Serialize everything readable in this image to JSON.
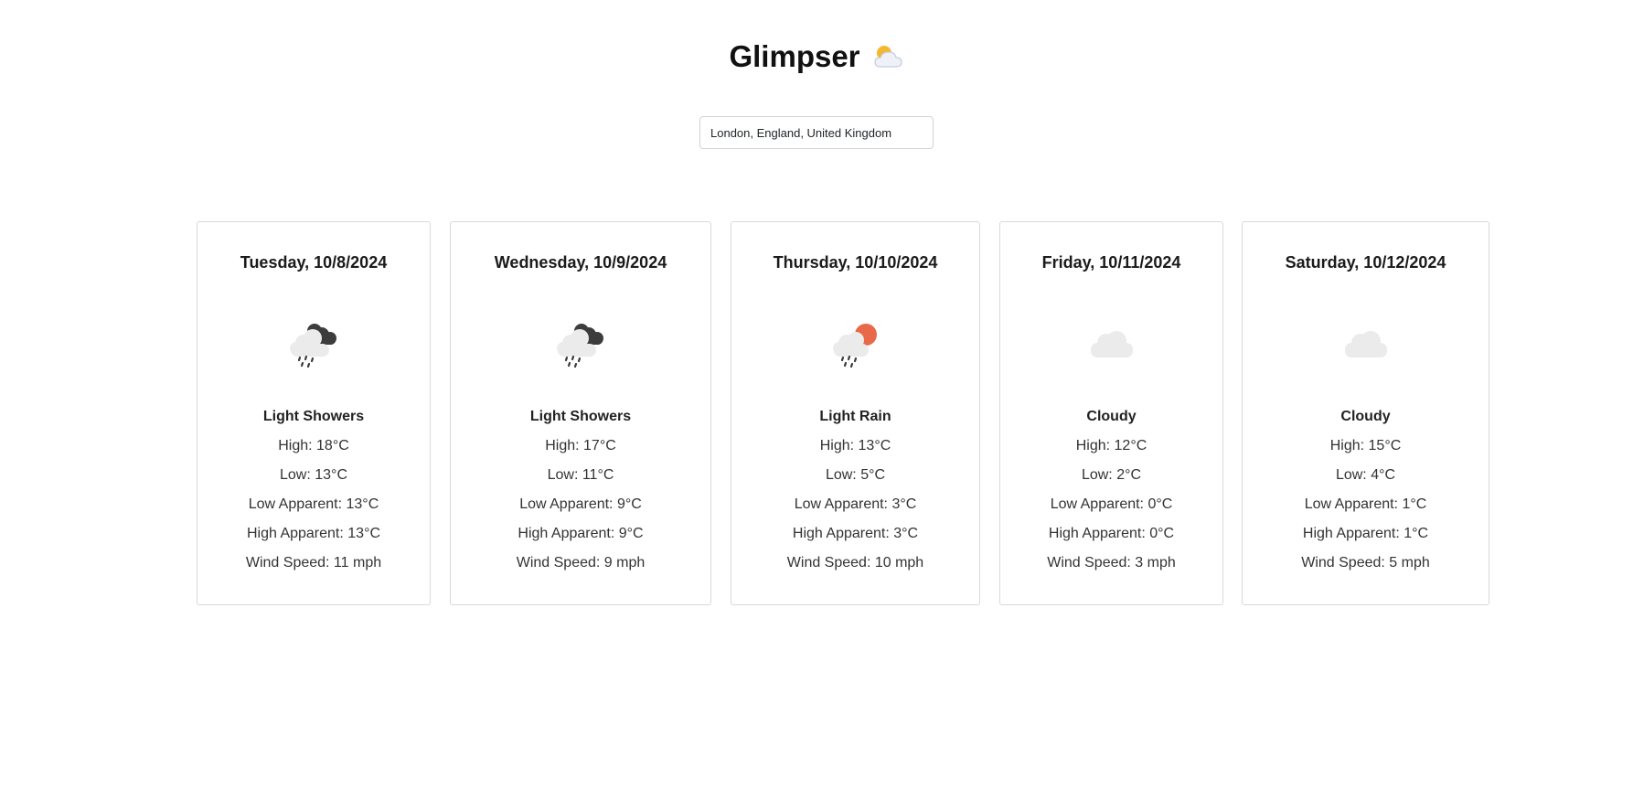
{
  "app": {
    "title": "Glimpser",
    "title_icon": "sun-behind-cloud-icon"
  },
  "search": {
    "value": "London, England, United Kingdom"
  },
  "forecast": [
    {
      "date": "Tuesday, 10/8/2024",
      "icon": "cloud-rain-showers-icon",
      "condition": "Light Showers",
      "high": "High: 18°C",
      "low": "Low: 13°C",
      "low_apparent": "Low Apparent: 13°C",
      "high_apparent": "High Apparent: 13°C",
      "wind": "Wind Speed: 11 mph"
    },
    {
      "date": "Wednesday, 10/9/2024",
      "icon": "cloud-rain-showers-icon",
      "condition": "Light Showers",
      "high": "High: 17°C",
      "low": "Low: 11°C",
      "low_apparent": "Low Apparent: 9°C",
      "high_apparent": "High Apparent: 9°C",
      "wind": "Wind Speed: 9 mph"
    },
    {
      "date": "Thursday, 10/10/2024",
      "icon": "sun-cloud-rain-icon",
      "condition": "Light Rain",
      "high": "High: 13°C",
      "low": "Low: 5°C",
      "low_apparent": "Low Apparent: 3°C",
      "high_apparent": "High Apparent: 3°C",
      "wind": "Wind Speed: 10 mph"
    },
    {
      "date": "Friday, 10/11/2024",
      "icon": "cloud-icon",
      "condition": "Cloudy",
      "high": "High: 12°C",
      "low": "Low: 2°C",
      "low_apparent": "Low Apparent: 0°C",
      "high_apparent": "High Apparent: 0°C",
      "wind": "Wind Speed: 3 mph"
    },
    {
      "date": "Saturday, 10/12/2024",
      "icon": "cloud-icon",
      "condition": "Cloudy",
      "high": "High: 15°C",
      "low": "Low: 4°C",
      "low_apparent": "Low Apparent: 1°C",
      "high_apparent": "High Apparent: 1°C",
      "wind": "Wind Speed: 5 mph"
    }
  ],
  "colors": {
    "card_border": "#d9d9d9",
    "cloud_light": "#e8e8e8",
    "cloud_dark": "#3c3c3c",
    "sun": "#e8684a"
  }
}
